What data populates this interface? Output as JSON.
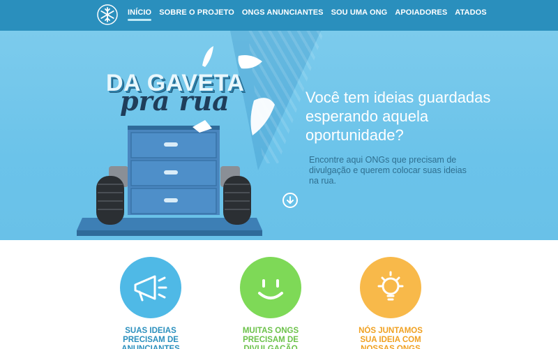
{
  "nav": {
    "logo_icon": "snowflake-icon",
    "items": [
      {
        "label": "INÍCIO",
        "active": true
      },
      {
        "label": "SOBRE O PROJETO",
        "active": false
      },
      {
        "label": "ONGS ANUNCIANTES",
        "active": false
      },
      {
        "label": "SOU UMA ONG",
        "active": false
      },
      {
        "label": "APOIADORES",
        "active": false
      },
      {
        "label": "ATADOS",
        "active": false
      }
    ]
  },
  "hero": {
    "title_line1": "DA GAVETA",
    "title_line2": "pra rua",
    "headline": "Você tem ideias guardadas esperando aquela oportunidade?",
    "subtext": "Encontre aqui ONGs que precisam de divulgação e querem colocar suas ideias na rua.",
    "scroll_icon": "arrow-down-circle-icon"
  },
  "features": [
    {
      "label": "SUAS IDEIAS PRECISAM DE ANUNCIANTES",
      "icon": "megaphone-icon",
      "color": "#4fb9e6",
      "text_color": "#2a8fbd"
    },
    {
      "label": "MUITAS ONGS PRECISAM DE DIVULGAÇÃO",
      "icon": "smile-icon",
      "color": "#7ed957",
      "text_color": "#6cc24a"
    },
    {
      "label": "NÓS JUNTAMOS SUA IDEIA COM NOSSAS ONGS",
      "icon": "lightbulb-icon",
      "color": "#f8b94a",
      "text_color": "#f0a020"
    }
  ],
  "colors": {
    "nav_bg": "#2a8fbd",
    "hero_bg": "#72c6ea",
    "drawer": "#4a86bf"
  }
}
